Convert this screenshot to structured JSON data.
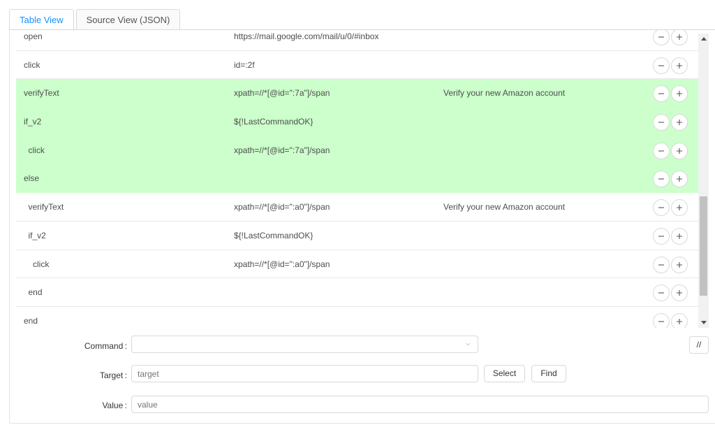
{
  "tabs": [
    {
      "label": "Table View",
      "active": true
    },
    {
      "label": "Source View (JSON)",
      "active": false
    }
  ],
  "rows": [
    {
      "command": "open",
      "target": "https://mail.google.com/mail/u/0/#inbox",
      "value": "",
      "highlight": false,
      "indent": 0
    },
    {
      "command": "click",
      "target": "id=:2f",
      "value": "",
      "highlight": false,
      "indent": 0
    },
    {
      "command": "verifyText",
      "target": "xpath=//*[@id=\":7a\"]/span",
      "value": "Verify your new Amazon account",
      "highlight": true,
      "indent": 0
    },
    {
      "command": "if_v2",
      "target": "${!LastCommandOK}",
      "value": "",
      "highlight": true,
      "indent": 0
    },
    {
      "command": "click",
      "target": "xpath=//*[@id=\":7a\"]/span",
      "value": "",
      "highlight": true,
      "indent": 1
    },
    {
      "command": "else",
      "target": "",
      "value": "",
      "highlight": true,
      "indent": 0
    },
    {
      "command": "verifyText",
      "target": "xpath=//*[@id=\":a0\"]/span",
      "value": "Verify your new Amazon account",
      "highlight": false,
      "indent": 1
    },
    {
      "command": "if_v2",
      "target": "${!LastCommandOK}",
      "value": "",
      "highlight": false,
      "indent": 1
    },
    {
      "command": "click",
      "target": "xpath=//*[@id=\":a0\"]/span",
      "value": "",
      "highlight": false,
      "indent": 2
    },
    {
      "command": "end",
      "target": "",
      "value": "",
      "highlight": false,
      "indent": 1
    },
    {
      "command": "end",
      "target": "",
      "value": "",
      "highlight": false,
      "indent": 0
    }
  ],
  "editor": {
    "command_label": "Command",
    "command_value": "",
    "target_label": "Target",
    "target_placeholder": "target",
    "value_label": "Value",
    "value_placeholder": "value",
    "select_button": "Select",
    "find_button": "Find",
    "comment_button": "//"
  },
  "icons": {
    "remove": "minus-icon",
    "add": "plus-icon",
    "dropdown": "chevron-down-icon"
  },
  "colors": {
    "accent": "#1890ff",
    "highlight_row": "#ccffcc",
    "border": "#d9d9d9"
  }
}
